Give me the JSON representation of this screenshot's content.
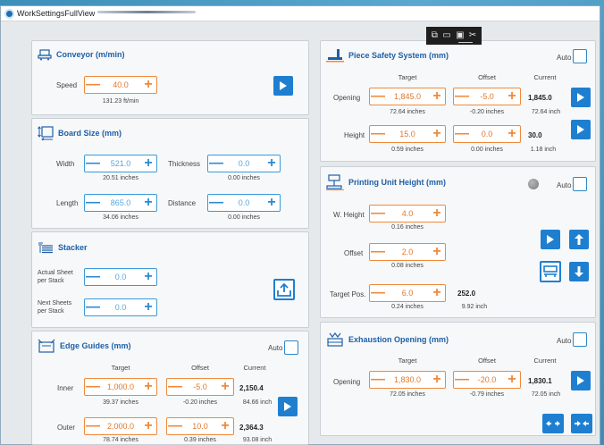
{
  "window": {
    "title": "WorkSettingsFullView"
  },
  "conveyor": {
    "title": "Conveyor (m/min)",
    "speed_label": "Speed",
    "speed_value": "40.0",
    "speed_sub": "131.23 ft/min"
  },
  "board": {
    "title": "Board Size (mm)",
    "width_label": "Width",
    "width_value": "521.0",
    "width_sub": "20.51 inches",
    "thickness_label": "Thickness",
    "thickness_value": "0.0",
    "thickness_sub": "0.00 inches",
    "length_label": "Length",
    "length_value": "865.0",
    "length_sub": "34.06 inches",
    "distance_label": "Distance",
    "distance_value": "0.0",
    "distance_sub": "0.00 inches"
  },
  "stacker": {
    "title": "Stacker",
    "actual_label_1": "Actual Sheet",
    "actual_label_2": "per Stack",
    "actual_value": "0.0",
    "next_label_1": "Next Sheets",
    "next_label_2": "per Stack",
    "next_value": "0.0"
  },
  "edge": {
    "title": "Edge Guides (mm)",
    "auto": "Auto",
    "col_target": "Target",
    "col_offset": "Offset",
    "col_current": "Current",
    "inner_label": "Inner",
    "inner_target": "1,000.0",
    "inner_offset": "-5.0",
    "inner_current": "2,150.4",
    "inner_target_sub": "39.37 inches",
    "inner_offset_sub": "-0.20 inches",
    "inner_current_sub": "84.66 inch",
    "outer_label": "Outer",
    "outer_target": "2,000.0",
    "outer_offset": "10.0",
    "outer_current": "2,364.3",
    "outer_target_sub": "78.74 inches",
    "outer_offset_sub": "0.39 inches",
    "outer_current_sub": "93.08 inch"
  },
  "piece": {
    "title": "Piece Safety System (mm)",
    "auto": "Auto",
    "col_target": "Target",
    "col_offset": "Offset",
    "col_current": "Current",
    "opening_label": "Opening",
    "opening_target": "1,845.0",
    "opening_offset": "-5.0",
    "opening_current": "1,845.0",
    "opening_target_sub": "72.64 inches",
    "opening_offset_sub": "-0.20 inches",
    "opening_current_sub": "72.64 inch",
    "height_label": "Height",
    "height_target": "15.0",
    "height_offset": "0.0",
    "height_current": "30.0",
    "height_target_sub": "0.59 inches",
    "height_offset_sub": "0.00 inches",
    "height_current_sub": "1.18 inch"
  },
  "printing": {
    "title": "Printing Unit Height (mm)",
    "auto": "Auto",
    "wheight_label": "W. Height",
    "wheight_value": "4.0",
    "wheight_sub": "0.16 inches",
    "offset_label": "Offset",
    "offset_value": "2.0",
    "offset_sub": "0.08 inches",
    "target_label": "Target Pos.",
    "target_value": "6.0",
    "target_sub": "0.24 inches",
    "target_current": "252.0",
    "target_current_sub": "9.92 inch"
  },
  "exhaustion": {
    "title": "Exhaustion Opening (mm)",
    "auto": "Auto",
    "col_target": "Target",
    "col_offset": "Offset",
    "col_current": "Current",
    "opening_label": "Opening",
    "opening_target": "1,830.0",
    "opening_offset": "-20.0",
    "opening_current": "1,830.1",
    "opening_target_sub": "72.05 inches",
    "opening_offset_sub": "-0.79 inches",
    "opening_current_sub": "72.05 inch"
  },
  "stepper": {
    "minus": "—",
    "plus": "+"
  },
  "colors": {
    "accent": "#1e7fd1",
    "orange": "#f0893a",
    "title_blue": "#1e5fa8"
  }
}
